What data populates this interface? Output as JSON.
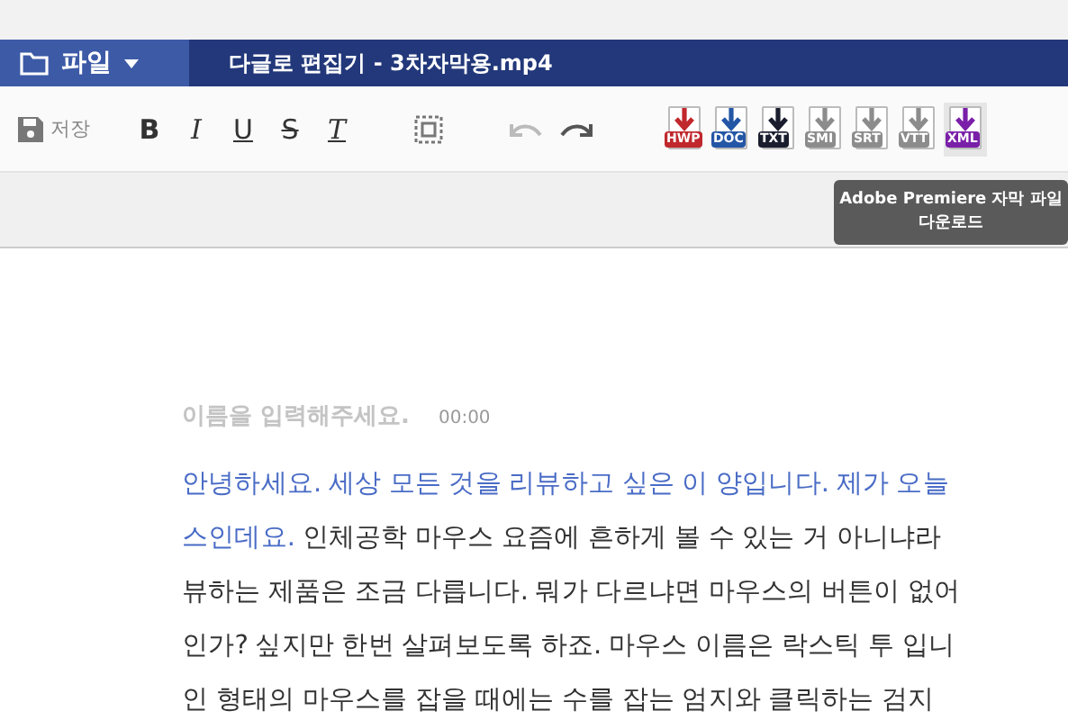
{
  "header": {
    "file_menu": "파일",
    "title": "다글로 편집기 - 3차자막용.mp4"
  },
  "toolbar": {
    "save": "저장",
    "format_buttons": [
      {
        "label": "B",
        "kind": "bold"
      },
      {
        "label": "I",
        "kind": "italic"
      },
      {
        "label": "U",
        "kind": "underline"
      },
      {
        "label": "S",
        "kind": "strike"
      },
      {
        "label": "T",
        "kind": "clear"
      }
    ],
    "undo_disabled": true,
    "downloads": [
      {
        "label": "HWP",
        "color": "#c0282d",
        "hovered": false
      },
      {
        "label": "DOC",
        "color": "#2456a6",
        "hovered": false
      },
      {
        "label": "TXT",
        "color": "#1a1d2e",
        "hovered": false
      },
      {
        "label": "SMI",
        "color": "#8c8c8c",
        "hovered": false
      },
      {
        "label": "SRT",
        "color": "#8c8c8c",
        "hovered": false
      },
      {
        "label": "VTT",
        "color": "#8c8c8c",
        "hovered": false
      },
      {
        "label": "XML",
        "color": "#7a1fa8",
        "hovered": true
      }
    ],
    "tooltip": "Adobe Premiere 자막 파일 다운로드"
  },
  "speaker": {
    "placeholder": "이름을 입력해주세요.",
    "time": "00:00"
  },
  "transcript": [
    {
      "segments": [
        {
          "text": "안녕하세요. 세상 모든 것을 리뷰하고 싶은 이 양입니다. 제가 오늘",
          "highlighted": true
        }
      ]
    },
    {
      "segments": [
        {
          "text": "스인데요.",
          "highlighted": true
        },
        {
          "text": " 인체공학 마우스 요즘에 흔하게 볼 수 있는 거 아니냐라",
          "highlighted": false
        }
      ]
    },
    {
      "segments": [
        {
          "text": "뷰하는 제품은 조금 다릅니다. 뭐가 다르냐면 마우스의 버튼이 없어",
          "highlighted": false
        }
      ]
    },
    {
      "segments": [
        {
          "text": "인가? 싶지만 한번 살펴보도록 하죠. 마우스 이름은 락스틱 투 입니",
          "highlighted": false
        }
      ]
    },
    {
      "segments": [
        {
          "text": "인 형태의 마우스를 잡을 때에는 수를 잡는 엄지와 클릭하는 검지",
          "highlighted": false
        }
      ]
    }
  ]
}
